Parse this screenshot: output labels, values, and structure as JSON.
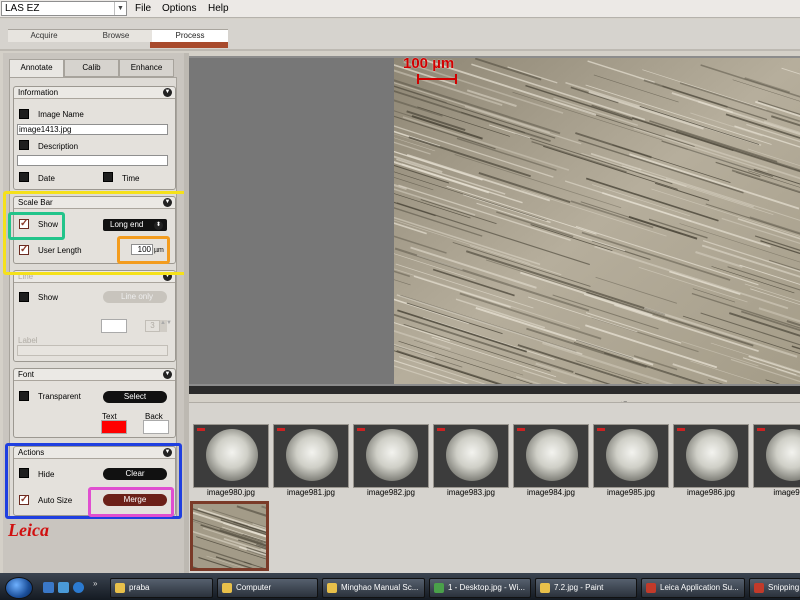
{
  "app": {
    "selector": "LAS EZ"
  },
  "menu": [
    "File",
    "Options",
    "Help"
  ],
  "workflow_tabs": [
    "Acquire",
    "Browse",
    "Process"
  ],
  "panel_tabs": [
    "Annotate",
    "Calib",
    "Enhance"
  ],
  "information": {
    "title": "Information",
    "image_name_label": "Image Name",
    "image_name_value": "image1413.jpg",
    "description_label": "Description",
    "description_value": "",
    "date_label": "Date",
    "time_label": "Time"
  },
  "scale_bar": {
    "title": "Scale Bar",
    "show_label": "Show",
    "style_value": "Long end",
    "user_length_label": "User Length",
    "user_length_value": "100",
    "unit": "µm"
  },
  "line": {
    "title": "Line",
    "show_label": "Show",
    "style_value": "Line only",
    "width_value": "3",
    "label_label": "Label"
  },
  "font": {
    "title": "Font",
    "transparent_label": "Transparent",
    "select_label": "Select",
    "text_label": "Text",
    "back_label": "Back",
    "text_color": "#ff0000",
    "back_color": "#ffffff"
  },
  "actions": {
    "title": "Actions",
    "hide_label": "Hide",
    "clear_label": "Clear",
    "auto_size_label": "Auto Size",
    "merge_label": "Merge"
  },
  "image_overlay": {
    "scale_text": "100 µm"
  },
  "thumbnails": [
    "image980.jpg",
    "image981.jpg",
    "image982.jpg",
    "image983.jpg",
    "image984.jpg",
    "image985.jpg",
    "image986.jpg",
    "image987"
  ],
  "logo": "Leica",
  "taskbar": {
    "buttons": [
      "praba",
      "Computer",
      "Minghao Manual Sc...",
      "1 - Desktop.jpg - Wi...",
      "7.2.jpg - Paint",
      "Leica Application Su...",
      "Snipping"
    ]
  },
  "highlight_colors": {
    "yellow": "#f5e11a",
    "green": "#22c48a",
    "orange": "#f39c1e",
    "blue": "#1f3fe0",
    "magenta": "#e04fd0"
  }
}
